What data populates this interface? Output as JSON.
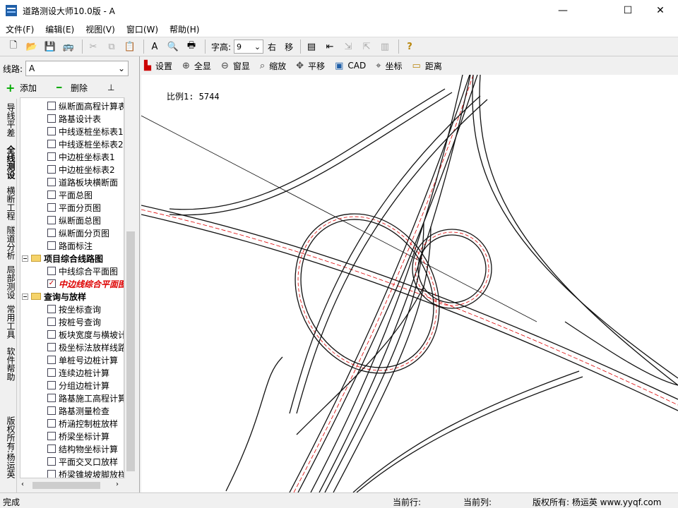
{
  "window": {
    "title": "道路测设大师10.0版 - A"
  },
  "menu": [
    "文件(F)",
    "编辑(E)",
    "视图(V)",
    "窗口(W)",
    "帮助(H)"
  ],
  "toolbar": {
    "font_label": "字高:",
    "font_value": "9",
    "right_label": "右",
    "move_label": "移"
  },
  "sidebar": {
    "line_label": "线路:",
    "line_value": "A",
    "add_label": "添加",
    "delete_label": "删除",
    "vtabs": [
      "导线平差",
      "全线测设",
      "横断工程",
      "隧道分析",
      "局部测设",
      "常用工具",
      "软件帮助",
      "版权所有:杨运英"
    ],
    "tree": [
      {
        "label": "纵断面高程计算表",
        "type": "check"
      },
      {
        "label": "路基设计表",
        "type": "check"
      },
      {
        "label": "中线逐桩坐标表1",
        "type": "check"
      },
      {
        "label": "中线逐桩坐标表2",
        "type": "check"
      },
      {
        "label": "中边桩坐标表1",
        "type": "check"
      },
      {
        "label": "中边桩坐标表2",
        "type": "check"
      },
      {
        "label": "道路板块横断面",
        "type": "check"
      },
      {
        "label": "平面总图",
        "type": "check"
      },
      {
        "label": "平面分页图",
        "type": "check"
      },
      {
        "label": "纵断面总图",
        "type": "check"
      },
      {
        "label": "纵断面分页图",
        "type": "check"
      },
      {
        "label": "路面标注",
        "type": "check"
      },
      {
        "label": "项目综合线路图",
        "type": "folder"
      },
      {
        "label": "中线综合平面图",
        "type": "check"
      },
      {
        "label": "中边线综合平面图",
        "type": "checked"
      },
      {
        "label": "查询与放样",
        "type": "folder"
      },
      {
        "label": "按坐标查询",
        "type": "check"
      },
      {
        "label": "按桩号查询",
        "type": "check"
      },
      {
        "label": "板块宽度与横坡计算",
        "type": "check"
      },
      {
        "label": "极坐标法放样线路",
        "type": "check"
      },
      {
        "label": "单桩号边桩计算",
        "type": "check"
      },
      {
        "label": "连续边桩计算",
        "type": "check"
      },
      {
        "label": "分组边桩计算",
        "type": "check"
      },
      {
        "label": "路基施工高程计算",
        "type": "check"
      },
      {
        "label": "路基测量检查",
        "type": "check"
      },
      {
        "label": "桥涵控制桩放样",
        "type": "check"
      },
      {
        "label": "桥梁坐标计算",
        "type": "check"
      },
      {
        "label": "结构物坐标计算",
        "type": "check"
      },
      {
        "label": "平面交叉口放样",
        "type": "check"
      },
      {
        "label": "桥梁锥坡坡脚放样",
        "type": "check"
      }
    ]
  },
  "viewtools": [
    {
      "icon": "settings-icon",
      "label": "设置"
    },
    {
      "icon": "zoom-all-icon",
      "label": "全显"
    },
    {
      "icon": "zoom-window-icon",
      "label": "窗显"
    },
    {
      "icon": "zoom-icon",
      "label": "缩放"
    },
    {
      "icon": "pan-icon",
      "label": "平移"
    },
    {
      "icon": "cad-icon",
      "label": "CAD"
    },
    {
      "icon": "coord-icon",
      "label": "坐标"
    },
    {
      "icon": "distance-icon",
      "label": "距离"
    }
  ],
  "canvas": {
    "scale_text": "比例1: 5744"
  },
  "status": {
    "left": "完成",
    "row_label": "当前行:",
    "col_label": "当前列:",
    "copyright": "版权所有: 杨运英 www.yyqf.com"
  }
}
